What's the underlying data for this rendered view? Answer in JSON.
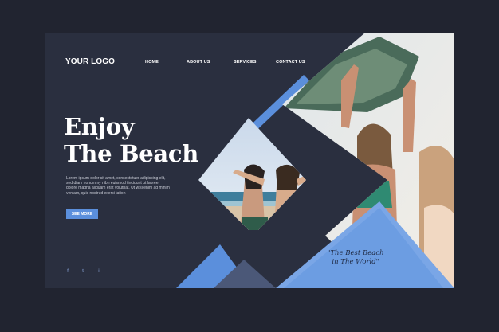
{
  "header": {
    "logo": "YOUR LOGO",
    "nav": [
      "HOME",
      "ABOUT US",
      "SERVICES",
      "CONTACT US"
    ]
  },
  "hero": {
    "title_line1": "Enjoy",
    "title_line2": "The Beach",
    "body": "Lorem ipsum dolor sit amet, consectetuer adipiscing elit, sed diam nonummy nibh euismod tincidunt ut laoreet dolore magna aliquam erat volutpat. Ut wisi enim ad minim veniam, quis nostrud exerci tation",
    "cta_label": "SEE MORE"
  },
  "quote": {
    "line1": "\"The Best Beach",
    "line2": "in The World\""
  },
  "social": [
    "f",
    "t",
    "i"
  ],
  "colors": {
    "background": "#212430",
    "panel": "#2a2f3f",
    "accent_blue": "#5b8fdc",
    "accent_dark": "#3a4360"
  },
  "icons": [
    "facebook-icon",
    "twitter-icon",
    "instagram-icon"
  ]
}
